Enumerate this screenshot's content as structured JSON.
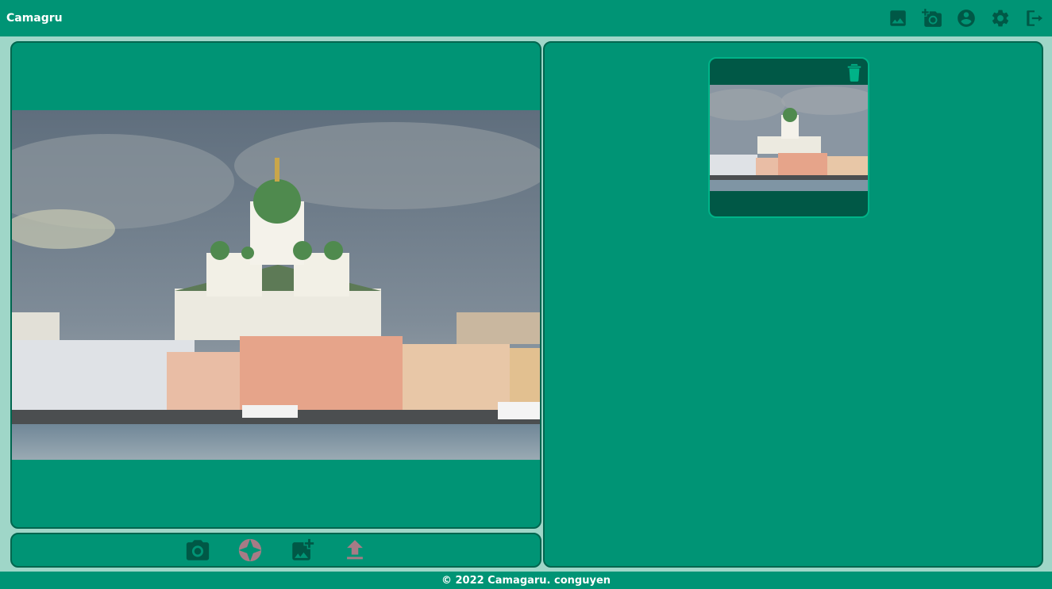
{
  "header": {
    "brand": "Camagru",
    "nav_icons": [
      "gallery-icon",
      "add-camera-icon",
      "account-icon",
      "settings-icon",
      "logout-icon"
    ]
  },
  "toolbar": {
    "icons": [
      "camera-icon",
      "shutter-icon",
      "add-image-icon",
      "upload-icon"
    ]
  },
  "gallery": {
    "items": [
      {
        "delete_icon": "trash-icon"
      }
    ]
  },
  "footer": {
    "text": "© 2022 Camagaru. conguyen"
  },
  "colors": {
    "primary": "#009475",
    "background": "#9fd6c8",
    "dark": "#005846",
    "accent": "#00b388"
  }
}
